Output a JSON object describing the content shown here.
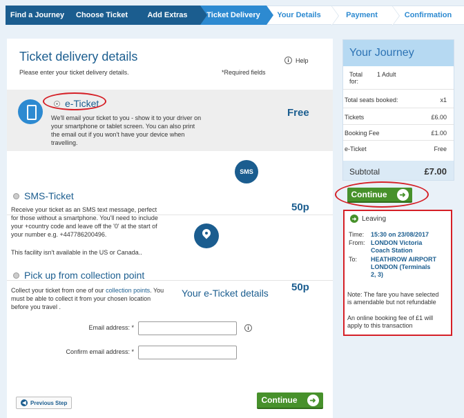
{
  "steps": [
    {
      "label": "Find a Journey",
      "state": "done"
    },
    {
      "label": "Choose Ticket",
      "state": "done"
    },
    {
      "label": "Add Extras",
      "state": "done"
    },
    {
      "label": "Ticket Delivery",
      "state": "active"
    },
    {
      "label": "Your Details",
      "state": "todo"
    },
    {
      "label": "Payment",
      "state": "todo"
    },
    {
      "label": "Confirmation",
      "state": "todo"
    }
  ],
  "main": {
    "title": "Ticket delivery details",
    "subtitle": "Please enter your ticket delivery details.",
    "required": "*Required fields",
    "help": "Help",
    "info_icon": "i"
  },
  "eticket": {
    "label": "e-Ticket",
    "price": "Free",
    "desc_lines": [
      "We'll email your ticket to you - show it to your driver on",
      "your smartphone or tablet screen. You can also print",
      "the email out if you won't have your device when",
      "travelling."
    ]
  },
  "sms": {
    "icon_text": "SMS",
    "label": "SMS-Ticket",
    "price": "50p",
    "desc_lines": [
      "Receive your ticket as an SMS text message, perfect",
      "for those without a smartphone. You'll need to include",
      "your +country code and leave off the '0' at the start of",
      "your number e.g. +447786200496."
    ],
    "note": "This facility isn't available in the US or Canada.."
  },
  "collection": {
    "label": "Pick up from collection point",
    "price": "50p",
    "desc_pre": "Collect your ticket from one of our ",
    "desc_link": "collection points",
    "desc_post": ". You",
    "desc_lines": [
      "must be able to collect it from your chosen location",
      "before you travel ."
    ]
  },
  "eticket_details": {
    "heading": "Your e-Ticket details",
    "email_label": "Email address: *",
    "confirm_label": "Confirm email address: *",
    "email_value": "",
    "confirm_value": ""
  },
  "buttons": {
    "previous": "Previous Step",
    "continue": "Continue"
  },
  "journey": {
    "heading": "Your Journey",
    "total_label": "Total",
    "total_label2": "for:",
    "total_value": "1 Adult",
    "seats_label": "Total seats booked:",
    "seats_value": "x1",
    "tickets_label": "Tickets",
    "tickets_value": "£6.00",
    "fee_label": "Booking Fee",
    "fee_value": "£1.00",
    "eticket_label": "e-Ticket",
    "eticket_value": "Free",
    "subtotal_label": "Subtotal",
    "subtotal_value": "£7.00"
  },
  "leaving": {
    "heading": "Leaving",
    "time_label": "Time:",
    "time_value": "15:30 on 23/08/2017",
    "from_label": "From:",
    "from_lines": [
      "LONDON Victoria",
      "Coach Station"
    ],
    "to_label": "To:",
    "to_lines": [
      "HEATHROW AIRPORT",
      "LONDON (Terminals",
      "2, 3)"
    ],
    "note_lines": [
      "Note: The fare you have selected",
      "is amendable but not refundable"
    ],
    "fee_lines": [
      "An online booking fee of £1 will",
      "apply to this transaction"
    ]
  },
  "colors": {
    "brand_dark": "#1b5d8f",
    "brand": "#2d8ad1",
    "continue_green": "#47912b",
    "highlight_red": "#d51f26"
  }
}
